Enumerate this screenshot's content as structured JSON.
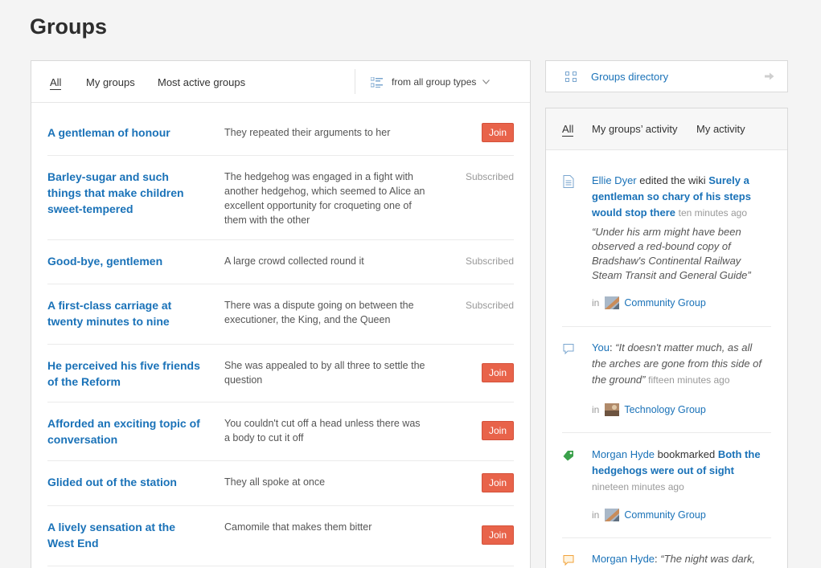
{
  "page": {
    "title": "Groups"
  },
  "tabs": {
    "all": "All",
    "my_groups": "My groups",
    "most_active": "Most active groups"
  },
  "filter": {
    "label": "from all group types"
  },
  "groups": [
    {
      "name": "A gentleman of honour",
      "desc": "They repeated their arguments to her",
      "status": "Join"
    },
    {
      "name": "Barley-sugar and such things that make children sweet-tempered",
      "desc": "The hedgehog was engaged in a fight with another hedgehog, which seemed to Alice an excellent opportunity for croqueting one of them with the other",
      "status": "Subscribed"
    },
    {
      "name": "Good-bye, gentlemen",
      "desc": "A large crowd collected round it",
      "status": "Subscribed"
    },
    {
      "name": "A first-class carriage at twenty minutes to nine",
      "desc": "There was a dispute going on between the executioner, the King, and the Queen",
      "status": "Subscribed"
    },
    {
      "name": "He perceived his five friends of the Reform",
      "desc": "She was appealed to by all three to settle the question",
      "status": "Join"
    },
    {
      "name": "Afforded an exciting topic of conversation",
      "desc": "You couldn't cut off a head unless there was a body to cut it off",
      "status": "Join"
    },
    {
      "name": "Glided out of the station",
      "desc": "They all spoke at once",
      "status": "Join"
    },
    {
      "name": "A lively sensation at the West End",
      "desc": "Camomile that makes them bitter",
      "status": "Join"
    }
  ],
  "sidebar": {
    "directory_label": "Groups directory",
    "activity_tabs": {
      "all": "All",
      "my_groups": "My groups’ activity",
      "mine": "My activity"
    },
    "in_label": "in",
    "activities": [
      {
        "icon": "wiki-page-icon",
        "actor": "Ellie Dyer",
        "verb": "edited the wiki",
        "target": "Surely a gentleman so chary of his steps would stop there",
        "time": "ten minutes ago",
        "quote": "“Under his arm might have been observed a red-bound copy of Bradshaw's Continental Railway Steam Transit and General Guide”",
        "group": "Community Group"
      },
      {
        "icon": "comment-icon",
        "actor": "You",
        "quote": "“It doesn't matter much, as all the arches are gone from this side of the ground”",
        "time": "fifteen minutes ago",
        "group": "Technology Group"
      },
      {
        "icon": "bookmark-icon",
        "actor": "Morgan Hyde",
        "verb": "bookmarked",
        "target": "Both the hedgehogs were out of sight",
        "time": "nineteen minutes ago",
        "group": "Community Group"
      },
      {
        "icon": "comment-icon",
        "actor": "Morgan Hyde",
        "quote": "“The night was dark,"
      }
    ]
  },
  "colors": {
    "link": "#1a72b8",
    "join": "#e8634a",
    "comment_icon_orange": "#f0a23a"
  }
}
